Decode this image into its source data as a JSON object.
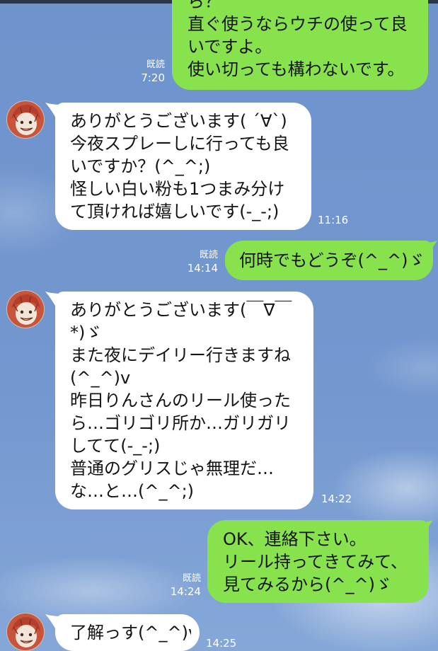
{
  "colors": {
    "sent_bubble": "#87e24e",
    "received_bubble": "#ffffff",
    "chat_background": "#6f93cc",
    "meta_text": "#ffffff",
    "message_text": "#141414"
  },
  "messages": [
    {
      "lines": [
        "ら？",
        "直ぐ使うならウチの使って良",
        "いですよ。",
        "使い切っても構わないです。"
      ],
      "read": "既読",
      "time": "7:20"
    },
    {
      "lines": [
        "ありがとうございます( ´∀`)",
        "今夜スプレーしに行っても良",
        "いですか？(^_^;)",
        "怪しい白い粉も1つまみ分け",
        "て頂ければ嬉しいです(-_-;)"
      ],
      "time": "11:16"
    },
    {
      "lines": [
        "何時でもどうぞ(^_^)ゞ"
      ],
      "read": "既読",
      "time": "14:14"
    },
    {
      "lines": [
        "ありがとうございます(￣∇￣",
        "*)ゞ",
        "また夜にデイリー行きますね",
        "(^_^)v",
        "昨日りんさんのリール使った",
        "ら…ゴリゴリ所か…ガリガリ",
        "してて(-_-;)",
        "普通のグリスじゃ無理だ…",
        "な…と…(^_^;)"
      ],
      "time": "14:22"
    },
    {
      "lines": [
        "OK、連絡下さい。",
        "リール持ってきてみて、",
        "見てみるから(^_^)ゞ"
      ],
      "read": "既読",
      "time": "14:24"
    },
    {
      "lines": [
        "了解っす(^_^)v"
      ],
      "time": "14:25"
    }
  ]
}
